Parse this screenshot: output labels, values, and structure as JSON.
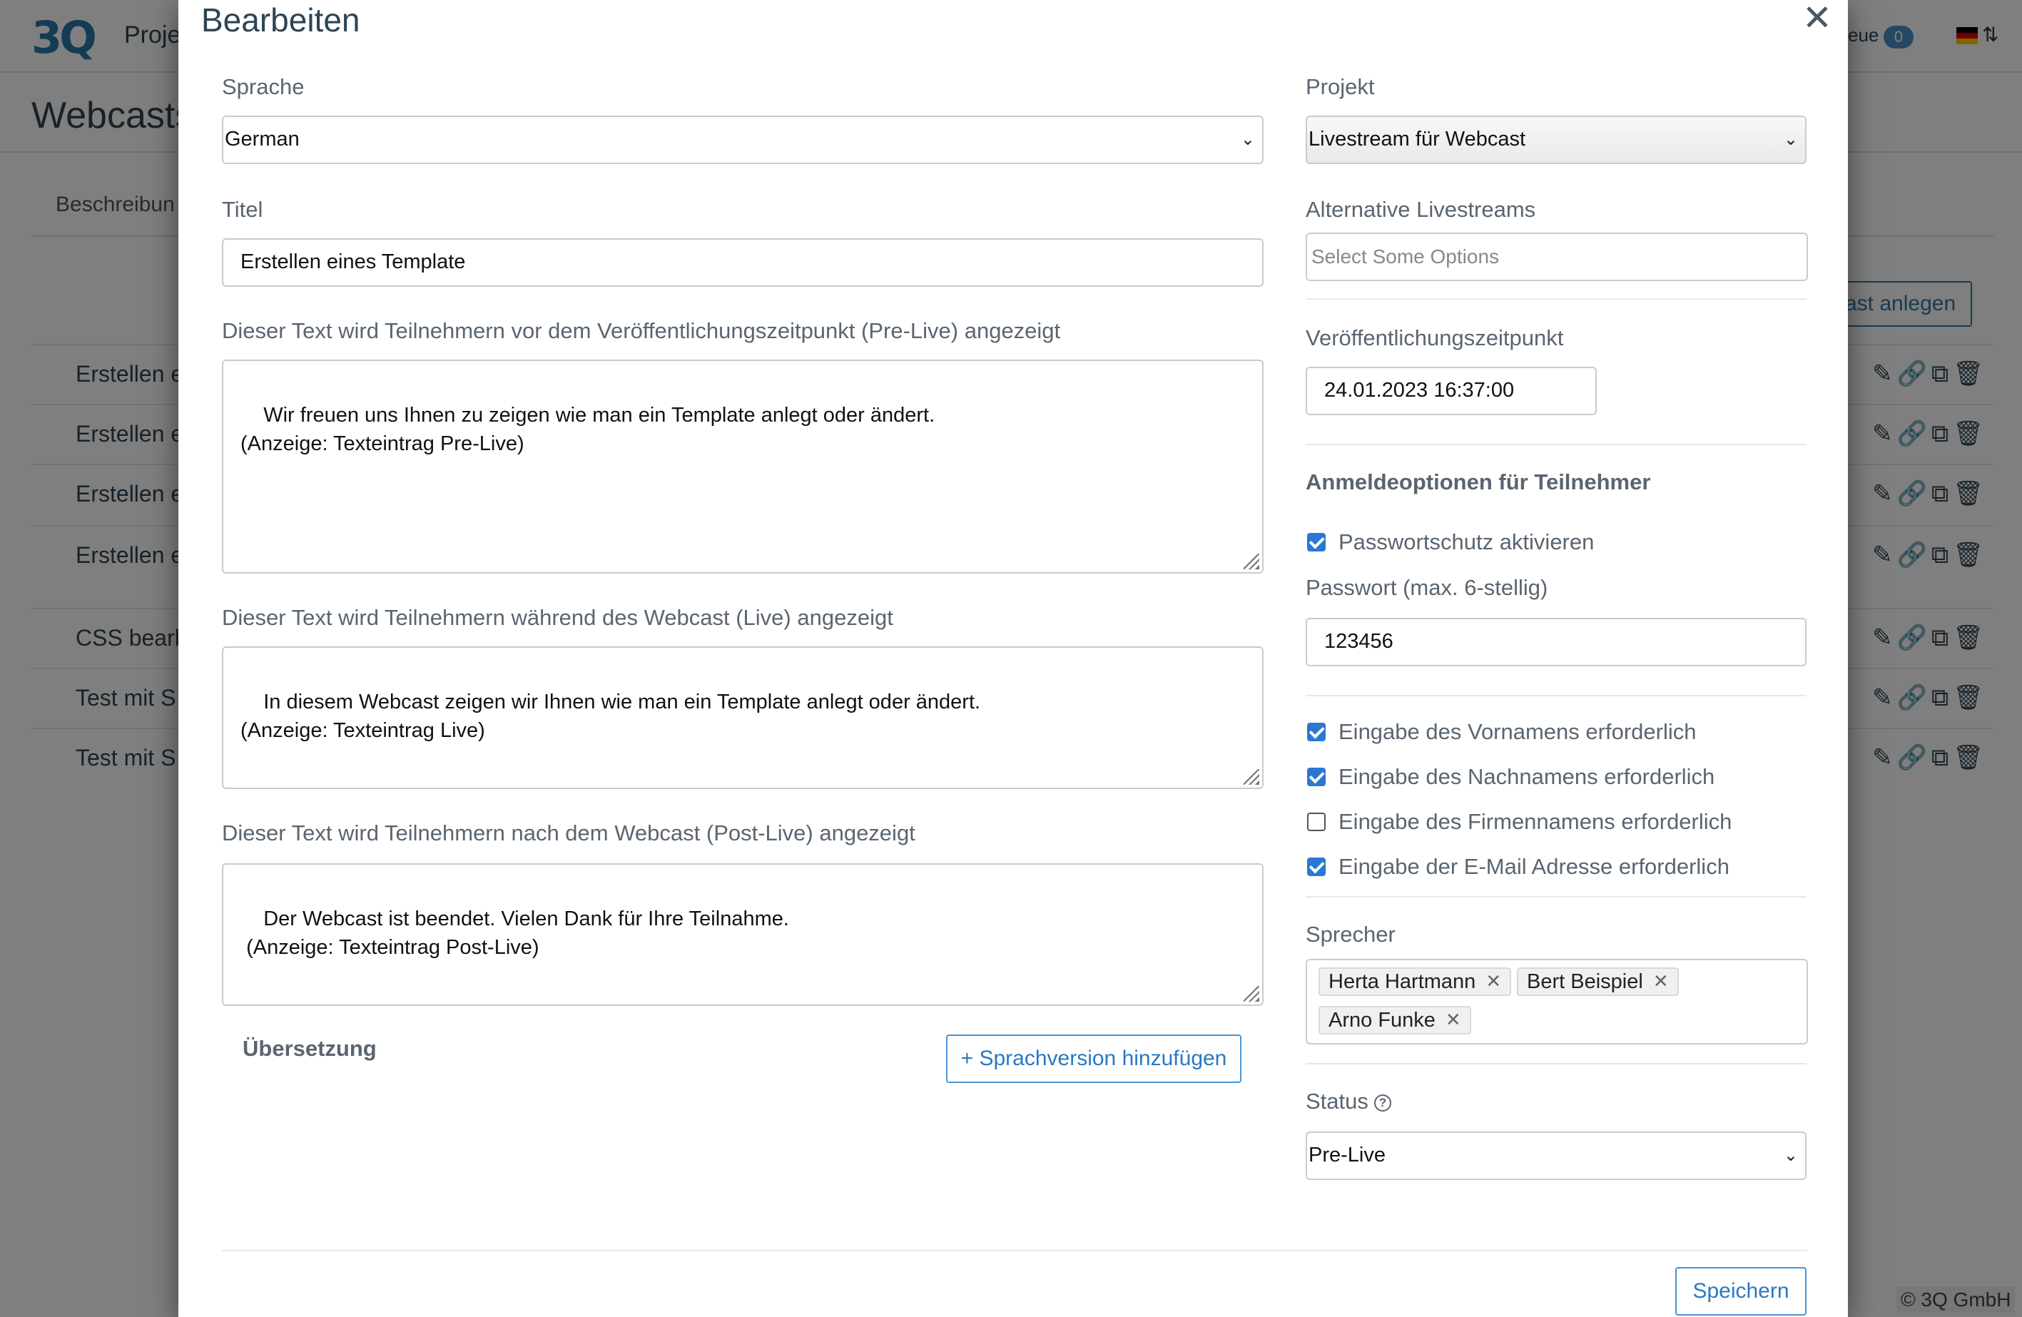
{
  "background": {
    "logo": "3Q",
    "project_label": "Proje",
    "queue_label": "eue",
    "queue_count": "0",
    "page_title": "Webcasts",
    "tab_label": "Beschreibun",
    "add_button": "ast anlegen",
    "rows": [
      "Erstellen e",
      "Erstellen e",
      "Erstellen e",
      "Erstellen e",
      "CSS bearb",
      "Test mit S",
      "Test mit S"
    ],
    "row_icons": "✎🔗⧉🗑",
    "footer": "© 3Q GmbH"
  },
  "modal": {
    "title": "Bearbeiten",
    "close_glyph": "✕",
    "left": {
      "language_label": "Sprache",
      "language_value": "German",
      "title_label": "Titel",
      "title_value": "Erstellen eines Template",
      "prelive_label": "Dieser Text wird Teilnehmern vor dem Veröffentlichungszeitpunkt (Pre-Live) angezeigt",
      "prelive_text": "Wir freuen uns Ihnen zu zeigen wie man ein Template anlegt oder ändert.\n(Anzeige: Texteintrag Pre-Live)",
      "live_label": "Dieser Text wird Teilnehmern während des Webcast (Live) angezeigt",
      "live_text": "In diesem Webcast zeigen wir Ihnen wie man ein Template anlegt oder ändert.\n(Anzeige: Texteintrag Live)",
      "postlive_label": "Dieser Text wird Teilnehmern nach dem Webcast (Post-Live) angezeigt",
      "postlive_text": "Der Webcast ist beendet. Vielen Dank für Ihre Teilnahme.\n (Anzeige: Texteintrag Post-Live)",
      "translation_label": "Übersetzung",
      "add_language_button": "+ Sprachversion hinzufügen"
    },
    "right": {
      "project_label": "Projekt",
      "project_value": "Livestream für Webcast",
      "alt_streams_label": "Alternative Livestreams",
      "alt_streams_placeholder": "Select Some Options",
      "publish_label": "Veröffentlichungszeitpunkt",
      "publish_value": "24.01.2023 16:37:00",
      "signup_heading": "Anmeldeoptionen für Teilnehmer",
      "password_protect_label": "Passwortschutz aktivieren",
      "password_protect_checked": true,
      "password_label": "Passwort (max. 6-stellig)",
      "password_value": "123456",
      "checkboxes": [
        {
          "label": "Eingabe des Vornamens erforderlich",
          "checked": true
        },
        {
          "label": "Eingabe des Nachnamens erforderlich",
          "checked": true
        },
        {
          "label": "Eingabe des Firmennamens erforderlich",
          "checked": false
        },
        {
          "label": "Eingabe der E-Mail Adresse erforderlich",
          "checked": true
        }
      ],
      "speakers_label": "Sprecher",
      "speakers": [
        "Herta Hartmann",
        "Bert Beispiel",
        "Arno Funke"
      ],
      "tag_remove_glyph": "✕",
      "status_label": "Status",
      "help_glyph": "?",
      "status_value": "Pre-Live"
    },
    "save_button": "Speichern",
    "select_chevron": "⌄"
  }
}
